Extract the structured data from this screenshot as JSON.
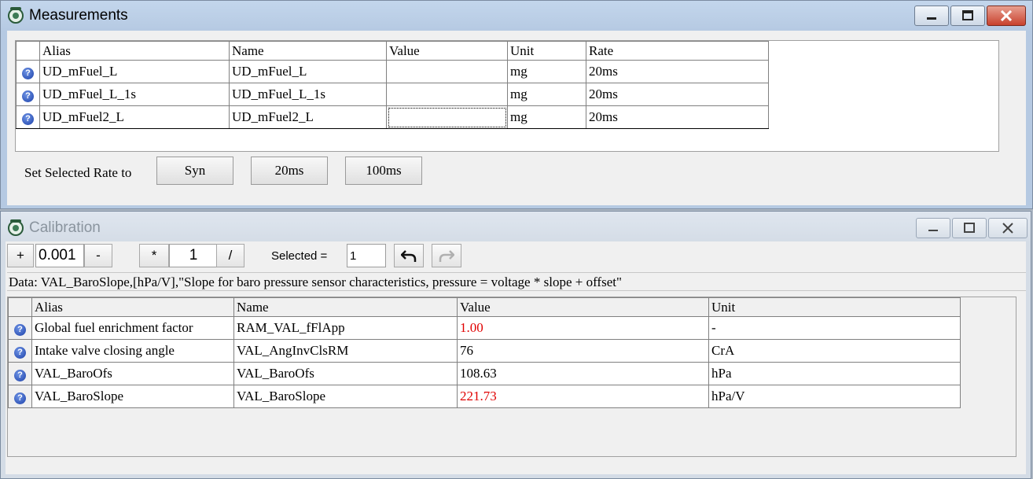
{
  "measurements": {
    "title": "Measurements",
    "columns": [
      "Alias",
      "Name",
      "Value",
      "Unit",
      "Rate"
    ],
    "rows": [
      {
        "alias": "UD_mFuel_L",
        "name": "UD_mFuel_L",
        "value": "",
        "unit": "mg",
        "rate": "20ms"
      },
      {
        "alias": "UD_mFuel_L_1s",
        "name": "UD_mFuel_L_1s",
        "value": "",
        "unit": "mg",
        "rate": "20ms"
      },
      {
        "alias": "UD_mFuel2_L",
        "name": "UD_mFuel2_L",
        "value": "",
        "unit": "mg",
        "rate": "20ms"
      }
    ],
    "rate_label": "Set Selected Rate to",
    "rate_buttons": [
      "Syn",
      "20ms",
      "100ms"
    ]
  },
  "calibration": {
    "title": "Calibration",
    "toolbar": {
      "plus": "+",
      "step": "0.001",
      "minus": "-",
      "mul": "*",
      "factor": "1",
      "div": "/",
      "selected_label": "Selected =",
      "selected_value": "1"
    },
    "data_line": "Data: VAL_BaroSlope,[hPa/V],\"Slope for baro pressure sensor characteristics, pressure = voltage * slope + offset\"",
    "columns": [
      "Alias",
      "Name",
      "Value",
      "Unit"
    ],
    "rows": [
      {
        "alias": "Global fuel enrichment factor",
        "name": "RAM_VAL_fFlApp",
        "value": "1.00",
        "unit": "-",
        "modified": true
      },
      {
        "alias": "Intake valve closing angle",
        "name": "VAL_AngInvClsRM",
        "value": "76",
        "unit": "CrA",
        "modified": false
      },
      {
        "alias": "VAL_BaroOfs",
        "name": "VAL_BaroOfs",
        "value": "108.63",
        "unit": "hPa",
        "modified": false
      },
      {
        "alias": "VAL_BaroSlope",
        "name": "VAL_BaroSlope",
        "value": "221.73",
        "unit": "hPa/V",
        "modified": true
      }
    ]
  },
  "colors": {
    "modified_value": "#e00000",
    "help_icon": "#1b3fa8"
  }
}
